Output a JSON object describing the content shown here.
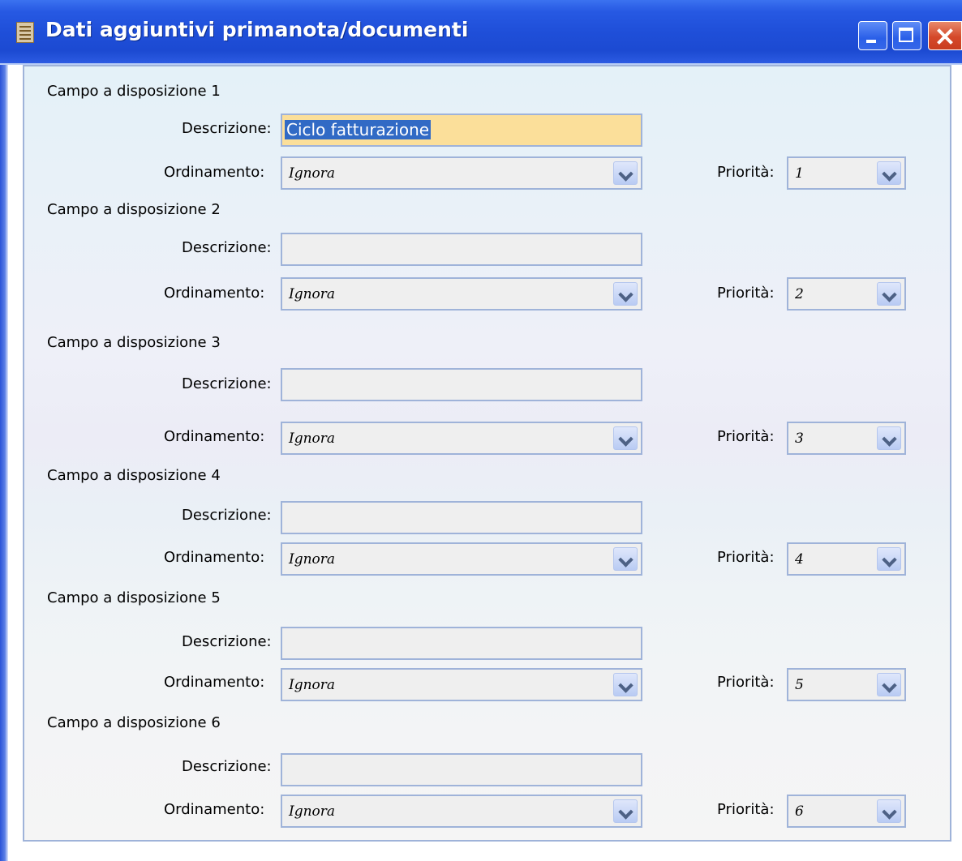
{
  "window": {
    "title": "Dati aggiuntivi primanota/documenti"
  },
  "labels": {
    "descrizione": "Descrizione:",
    "ordinamento": "Ordinamento:",
    "priorita": "Priorità:"
  },
  "fields": [
    {
      "title": "Campo a disposizione 1",
      "descrizione": "Ciclo fatturazione",
      "ordinamento": "Ignora",
      "priorita": "1"
    },
    {
      "title": "Campo a disposizione 2",
      "descrizione": "",
      "ordinamento": "Ignora",
      "priorita": "2"
    },
    {
      "title": "Campo a disposizione 3",
      "descrizione": "",
      "ordinamento": "Ignora",
      "priorita": "3"
    },
    {
      "title": "Campo a disposizione 4",
      "descrizione": "",
      "ordinamento": "Ignora",
      "priorita": "4"
    },
    {
      "title": "Campo a disposizione 5",
      "descrizione": "",
      "ordinamento": "Ignora",
      "priorita": "5"
    },
    {
      "title": "Campo a disposizione 6",
      "descrizione": "",
      "ordinamento": "Ignora",
      "priorita": "6"
    }
  ],
  "colors": {
    "titlebar": "#1f4fd9",
    "focused_field": "#fbdf9a",
    "selection": "#316ac5",
    "field_border": "#9fb3d9"
  },
  "icons": {
    "window_icon": "document-icon",
    "minimize": "minimize-icon",
    "maximize": "maximize-icon",
    "close": "close-icon",
    "dropdown": "chevron-down-icon"
  }
}
